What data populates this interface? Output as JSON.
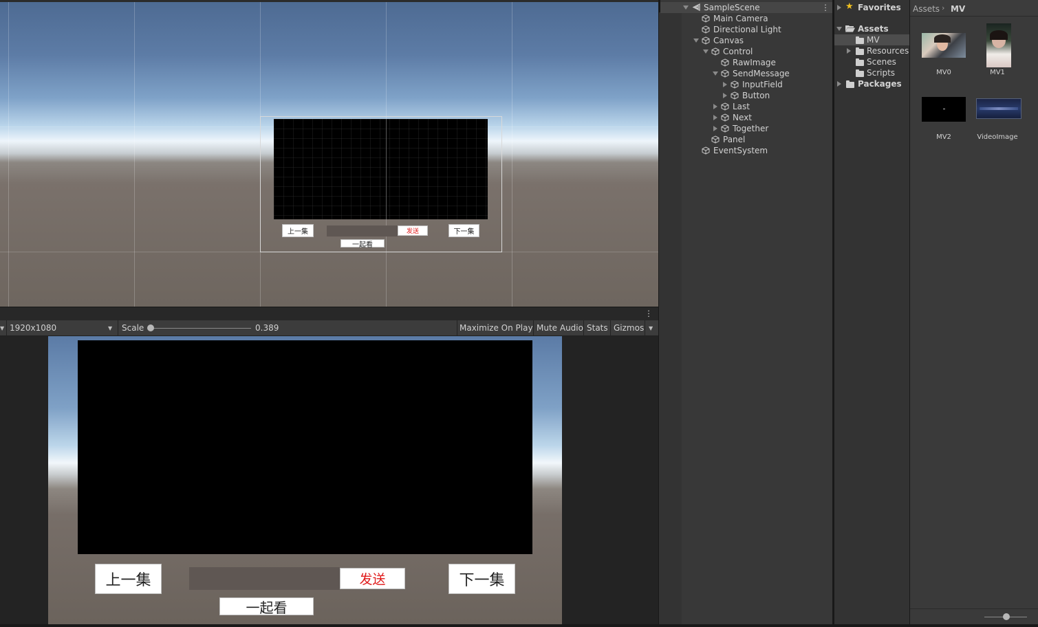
{
  "scene": {
    "buttons": {
      "prev": "上一集",
      "send": "发送",
      "next": "下一集",
      "together": "一起看"
    }
  },
  "game": {
    "resolution": "1920x1080",
    "scale_label": "Scale",
    "scale_value": "0.389",
    "scale_fraction": 0.02,
    "toolbar": [
      "Maximize On Play",
      "Mute Audio",
      "Stats",
      "Gizmos"
    ],
    "buttons": {
      "prev": "上一集",
      "send": "发送",
      "next": "下一集",
      "together": "一起看"
    },
    "send_color": "#e01b1b"
  },
  "hierarchy": {
    "scene_name": "SampleScene",
    "items": [
      {
        "label": "Main Camera"
      },
      {
        "label": "Directional Light"
      },
      {
        "label": "Canvas"
      },
      {
        "label": "Control"
      },
      {
        "label": "RawImage"
      },
      {
        "label": "SendMessage"
      },
      {
        "label": "InputField"
      },
      {
        "label": "Button"
      },
      {
        "label": "Last"
      },
      {
        "label": "Next"
      },
      {
        "label": "Together"
      },
      {
        "label": "Panel"
      },
      {
        "label": "EventSystem"
      }
    ]
  },
  "project": {
    "favorites": "Favorites",
    "assets": "Assets",
    "folders": [
      "MV",
      "Resources",
      "Scenes",
      "Scripts"
    ],
    "packages": "Packages",
    "breadcrumb": [
      "Assets",
      "MV"
    ],
    "grid_assets": [
      "MV0",
      "MV1",
      "MV2",
      "VideoImage"
    ]
  }
}
